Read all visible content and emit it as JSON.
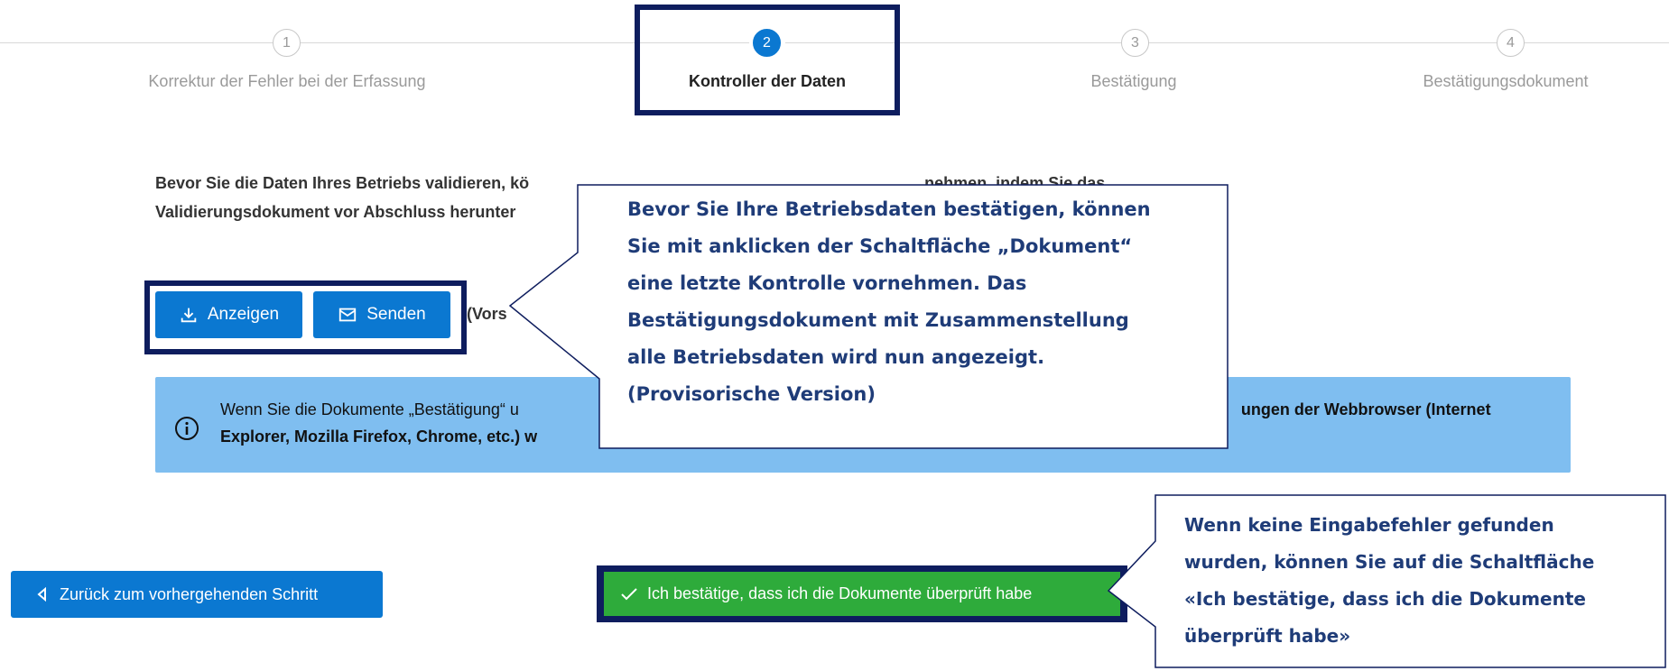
{
  "stepper": {
    "steps": [
      {
        "number": "1",
        "label": "Korrektur der Fehler bei der Erfassung"
      },
      {
        "number": "2",
        "label": "Kontroller der Daten"
      },
      {
        "number": "3",
        "label": "Bestätigung"
      },
      {
        "number": "4",
        "label": "Bestätigungsdokument"
      }
    ],
    "active_step": 2
  },
  "intro": {
    "text_line1": "Bevor Sie die Daten Ihres Betriebs validieren, kö",
    "text_line1_end": "nehmen, indem Sie das",
    "text_line2": "Validierungsdokument vor Abschluss herunter"
  },
  "actions": {
    "view_label": "Anzeigen",
    "send_label": "Senden",
    "suffix_text": "(Vors"
  },
  "info": {
    "line1_start": "Wenn Sie die Dokumente „Bestätigung“ u",
    "line1_end": "ungen der Webbrowser (Internet",
    "line2": "Explorer, Mozilla Firefox, Chrome, etc.) w"
  },
  "callouts": {
    "document_hint": [
      "Bevor Sie Ihre Betriebsdaten bestätigen, können",
      "Sie mit anklicken der Schaltfläche „Dokument“",
      "eine letzte Kontrolle vornehmen. Das",
      "Bestätigungsdokument mit Zusammenstellung",
      "alle Betriebsdaten wird nun angezeigt.",
      "(Provisorische Version)"
    ],
    "confirm_hint": [
      "Wenn keine Eingabefehler gefunden",
      "wurden, können Sie auf die Schaltfläche",
      "«Ich bestätige, dass ich die Dokumente",
      "überprüft habe»"
    ]
  },
  "footer": {
    "back_label": "Zurück zum vorhergehenden Schritt",
    "confirm_label": "Ich bestätige, dass ich die Dokumente überprüft habe"
  },
  "colors": {
    "primary": "#0b78d1",
    "highlight_border": "#0e1d5e",
    "success": "#2eab3b",
    "info_bg": "#7fbef0",
    "callout_text": "#1f3c78"
  }
}
